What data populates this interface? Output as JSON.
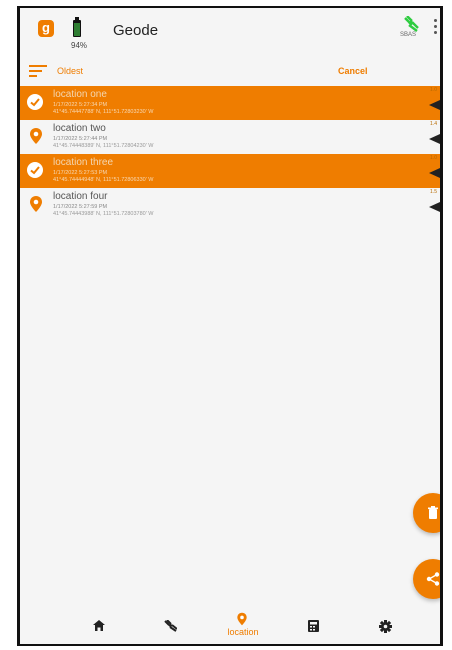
{
  "app": {
    "logo_letter": "g",
    "title": "Geode",
    "battery_percent": "94%",
    "battery_level": 0.94,
    "gps_status": "SBAS"
  },
  "sortbar": {
    "sort_label": "Oldest",
    "cancel_label": "Cancel"
  },
  "locations": [
    {
      "name": "location one",
      "date": "1/17/2022 5:27:34 PM",
      "coords": "41°45.74447788' N, 111°51.72803230' W",
      "selected": true,
      "tag": "1.0"
    },
    {
      "name": "location two",
      "date": "1/17/2022 5:27:44 PM",
      "coords": "41°45.74448389' N, 111°51.72804230' W",
      "selected": false,
      "tag": "1.4"
    },
    {
      "name": "location three",
      "date": "1/17/2022 5:27:53 PM",
      "coords": "41°45.74444948' N, 111°51.72806330' W",
      "selected": true,
      "tag": "1.0"
    },
    {
      "name": "location four",
      "date": "1/17/2022 5:27:59 PM",
      "coords": "41°45.74443988' N, 111°51.72803780' W",
      "selected": false,
      "tag": "1.5"
    }
  ],
  "nav": {
    "location_label": "location",
    "active_tab": "location"
  },
  "colors": {
    "accent": "#ef7d00",
    "background": "#f5f5f5",
    "gps_ok": "#2ecc40",
    "battery": "#2e7d32"
  },
  "icons": [
    "sort-icon",
    "check-icon",
    "pin-icon",
    "gps-icon",
    "more-icon",
    "trash-icon",
    "share-icon",
    "home-icon",
    "satellite-icon",
    "calculator-icon",
    "gear-icon"
  ]
}
